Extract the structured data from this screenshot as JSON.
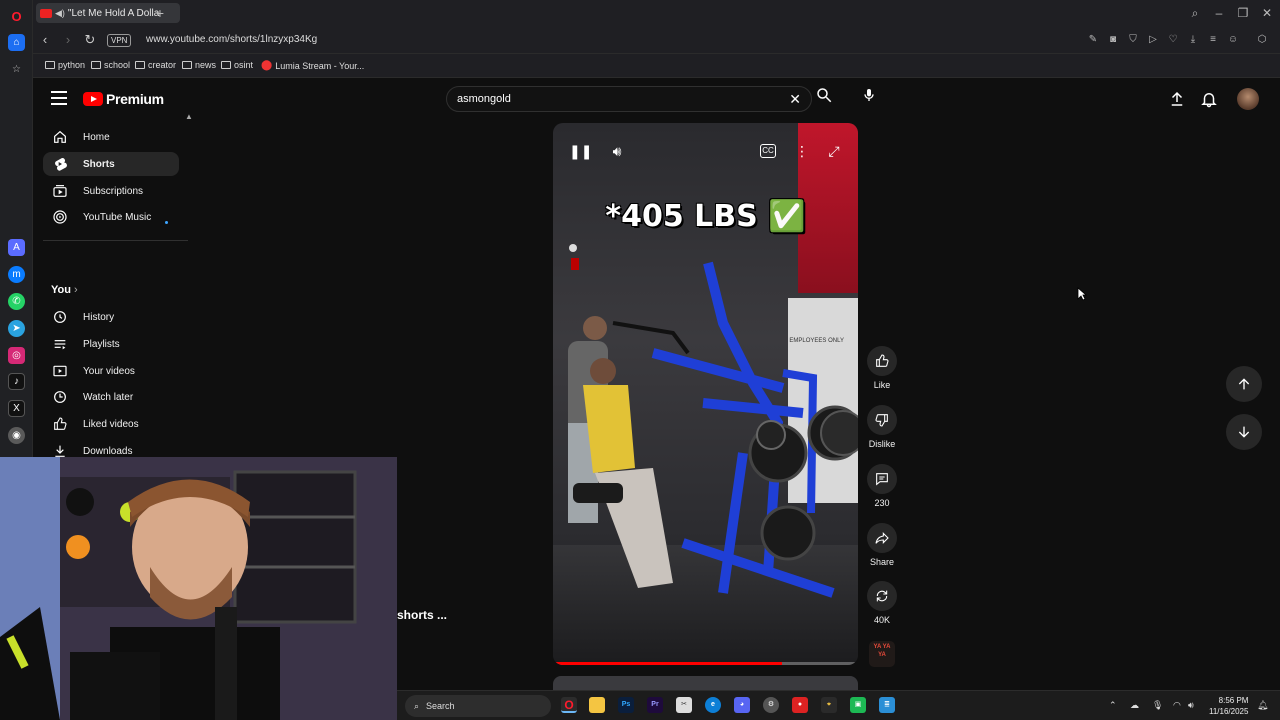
{
  "browser": {
    "tab_title": "\"Let Me Hold A Dolla",
    "url": "www.youtube.com/shorts/1lnzyxp34Kg",
    "vpn_label": "VPN",
    "bookmarks": [
      "python",
      "school",
      "creator",
      "news",
      "osint",
      "Lumia Stream - Your..."
    ]
  },
  "youtube": {
    "logo_text": "Premium",
    "search": {
      "value": "asmongold"
    },
    "nav": {
      "main": [
        {
          "label": "Home",
          "icon": "home-icon"
        },
        {
          "label": "Shorts",
          "icon": "shorts-icon",
          "active": true
        },
        {
          "label": "Subscriptions",
          "icon": "subscriptions-icon"
        },
        {
          "label": "YouTube Music",
          "icon": "youtube-music-icon"
        }
      ],
      "you_header": "You",
      "you": [
        {
          "label": "History",
          "icon": "history-icon"
        },
        {
          "label": "Playlists",
          "icon": "playlists-icon"
        },
        {
          "label": "Your videos",
          "icon": "your-videos-icon"
        },
        {
          "label": "Watch later",
          "icon": "watch-later-icon"
        },
        {
          "label": "Liked videos",
          "icon": "liked-videos-icon"
        },
        {
          "label": "Downloads",
          "icon": "downloads-icon"
        }
      ]
    },
    "short": {
      "overlay_text": "*405 LBS ✅",
      "wall_sign": "EMPLOYEES ONLY",
      "progress": 0.75,
      "actions": [
        {
          "label": "Like",
          "icon": "thumbs-up-icon"
        },
        {
          "label": "Dislike",
          "icon": "thumbs-down-icon"
        },
        {
          "label": "230",
          "icon": "comment-icon"
        },
        {
          "label": "Share",
          "icon": "share-icon"
        },
        {
          "label": "40K",
          "icon": "remix-icon"
        }
      ],
      "sound_thumb_text": "YA YA YA",
      "channel_fragment": "shorts ..."
    }
  },
  "taskbar": {
    "search_label": "Search",
    "time": "8:56 PM",
    "date": "11/16/2025"
  }
}
